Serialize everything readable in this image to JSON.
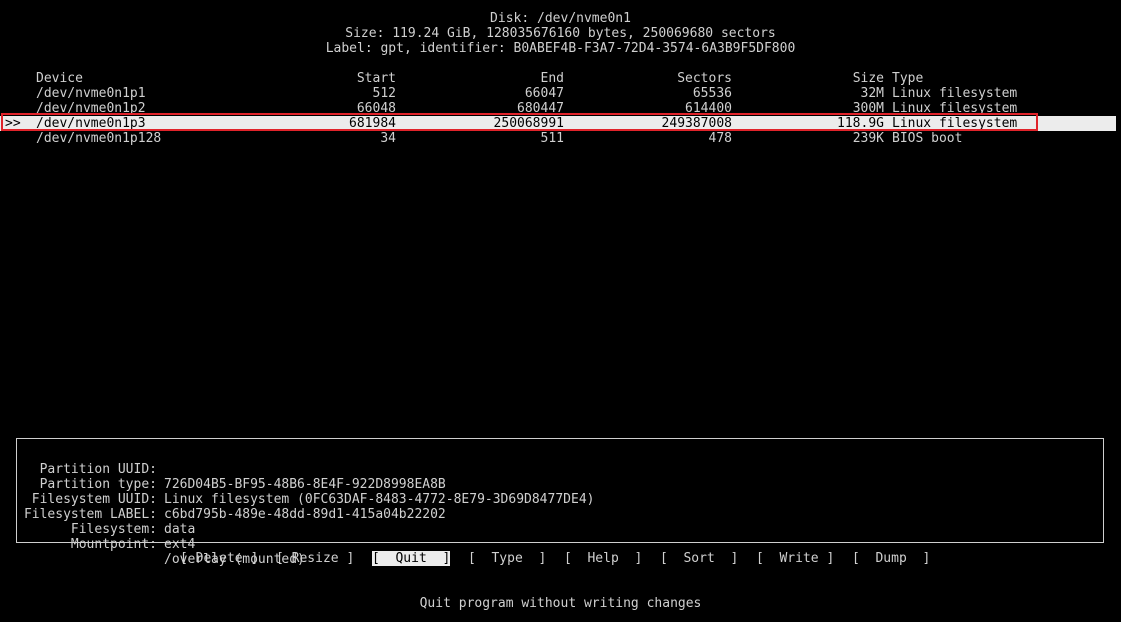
{
  "header": {
    "disk": "Disk: /dev/nvme0n1",
    "size": "Size: 119.24 GiB, 128035676160 bytes, 250069680 sectors",
    "label": "Label: gpt, identifier: B0ABEF4B-F3A7-72D4-3574-6A3B9F5DF800"
  },
  "table": {
    "columns": [
      "Device",
      "Start",
      "End",
      "Sectors",
      "Size",
      "Type"
    ],
    "selected_marker": ">>",
    "rows": [
      {
        "device": "/dev/nvme0n1p1",
        "start": "512",
        "end": "66047",
        "sectors": "65536",
        "size": "32M",
        "type": "Linux filesystem"
      },
      {
        "device": "/dev/nvme0n1p2",
        "start": "66048",
        "end": "680447",
        "sectors": "614400",
        "size": "300M",
        "type": "Linux filesystem"
      },
      {
        "device": "/dev/nvme0n1p3",
        "start": "681984",
        "end": "250068991",
        "sectors": "249387008",
        "size": "118.9G",
        "type": "Linux filesystem"
      },
      {
        "device": "/dev/nvme0n1p128",
        "start": "34",
        "end": "511",
        "sectors": "478",
        "size": "239K",
        "type": "BIOS boot"
      }
    ]
  },
  "info": [
    {
      "key": "Partition UUID:",
      "value": "726D04B5-BF95-48B6-8E4F-922D8998EA8B"
    },
    {
      "key": "Partition type:",
      "value": "Linux filesystem (0FC63DAF-8483-4772-8E79-3D69D8477DE4)"
    },
    {
      "key": "Filesystem UUID:",
      "value": "c6bd795b-489e-48dd-89d1-415a04b22202"
    },
    {
      "key": "Filesystem LABEL:",
      "value": "data"
    },
    {
      "key": "Filesystem:",
      "value": "ext4"
    },
    {
      "key": "Mountpoint:",
      "value": "/overlay (mounted)"
    }
  ],
  "menu": [
    {
      "label": "[ Delete ]"
    },
    {
      "label": "[ Resize ]"
    },
    {
      "label": "[  Quit  ]"
    },
    {
      "label": "[  Type  ]"
    },
    {
      "label": "[  Help  ]"
    },
    {
      "label": "[  Sort  ]"
    },
    {
      "label": "[  Write ]"
    },
    {
      "label": "[  Dump  ]"
    }
  ],
  "status": "Quit program without writing changes",
  "colors": {
    "background": "#000000",
    "text": "#d0d0d0",
    "selection": "#ececec",
    "highlight_border": "#e0232a"
  }
}
